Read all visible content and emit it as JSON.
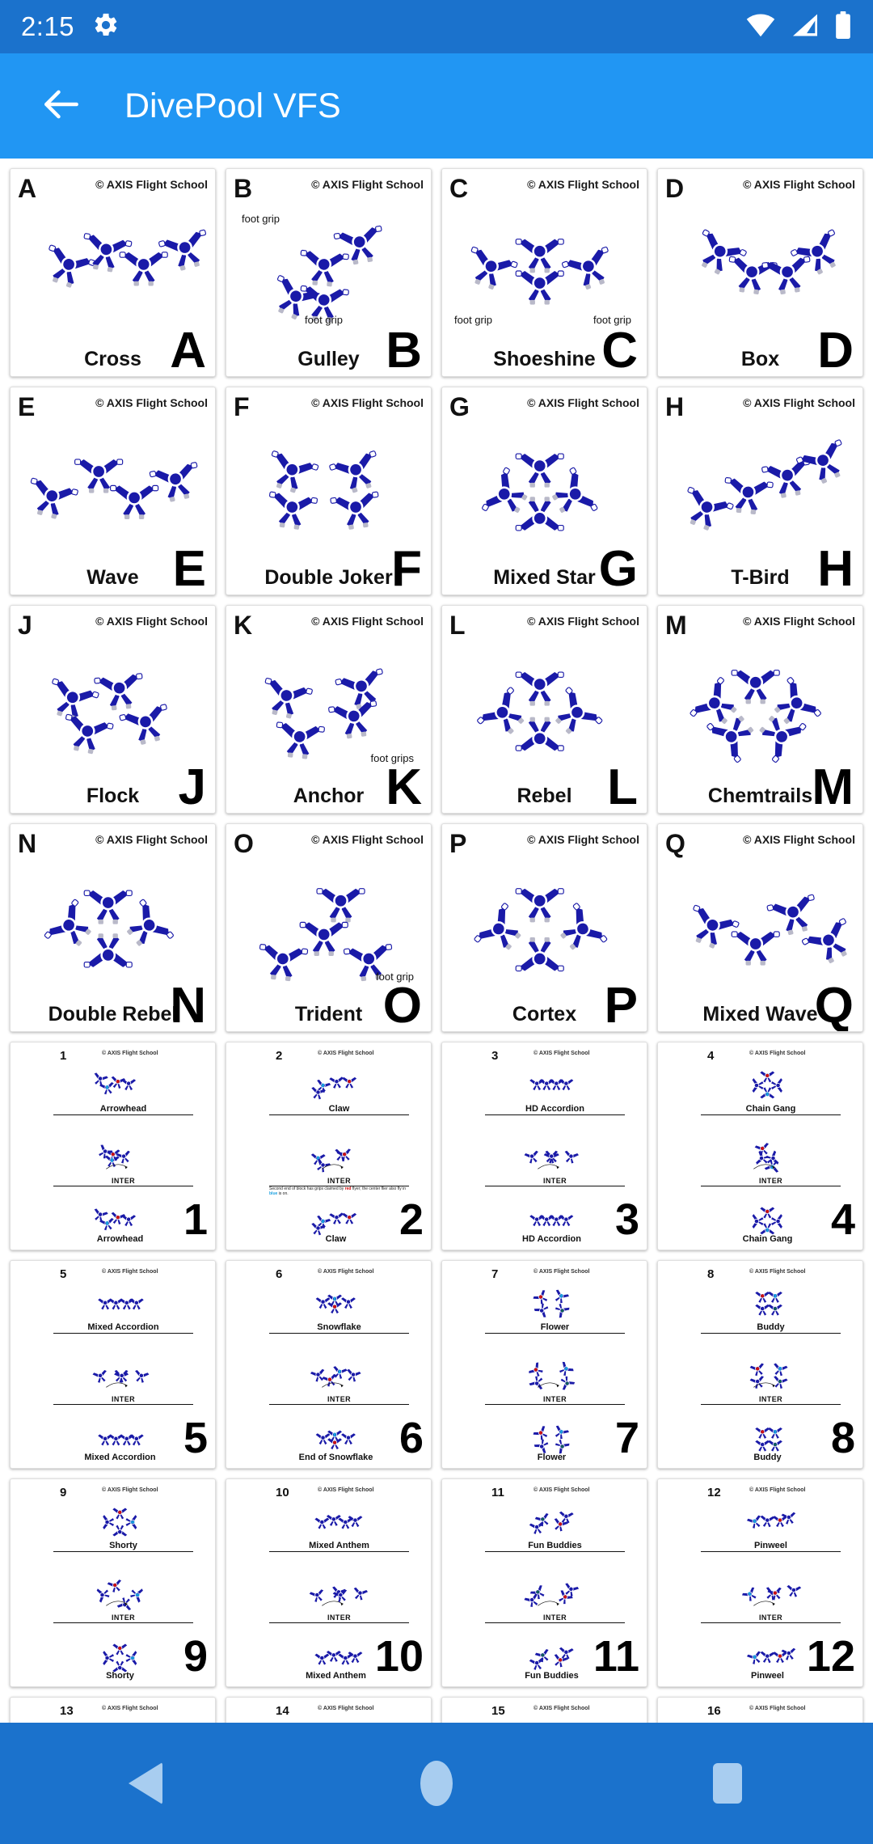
{
  "status_bar": {
    "time": "2:15",
    "left_icons": [
      "gear-icon"
    ],
    "right_icons": [
      "wifi-icon",
      "cellular-signal-icon",
      "battery-icon"
    ],
    "background_color": "#1b72cc"
  },
  "app_bar": {
    "title": "DivePool VFS",
    "back_icon": "arrow-left-icon",
    "background_color": "#2196f3"
  },
  "copyright": "© AXIS Flight School",
  "inter_label": "INTER",
  "colors": {
    "formation_blue": "#1a1aa8",
    "accent_blue": "#2196f3",
    "status_blue": "#1b72cc",
    "nav_icon_blue": "#a8cdf0",
    "red_marker": "#cc1111",
    "cyan_marker": "#19a0e0",
    "green_marker": "#0a8a2a"
  },
  "letter_cards": [
    {
      "letter": "A",
      "name": "Cross",
      "annotations": []
    },
    {
      "letter": "B",
      "name": "Gulley",
      "annotations": [
        "foot grip",
        "foot grip"
      ]
    },
    {
      "letter": "C",
      "name": "Shoeshine",
      "annotations": [
        "foot grip",
        "foot grip"
      ]
    },
    {
      "letter": "D",
      "name": "Box",
      "annotations": []
    },
    {
      "letter": "E",
      "name": "Wave",
      "annotations": []
    },
    {
      "letter": "F",
      "name": "Double Joker",
      "annotations": []
    },
    {
      "letter": "G",
      "name": "Mixed Star",
      "annotations": []
    },
    {
      "letter": "H",
      "name": "T-Bird",
      "annotations": []
    },
    {
      "letter": "J",
      "name": "Flock",
      "annotations": []
    },
    {
      "letter": "K",
      "name": "Anchor",
      "annotations": [
        "foot grips"
      ]
    },
    {
      "letter": "L",
      "name": "Rebel",
      "annotations": []
    },
    {
      "letter": "M",
      "name": "Chemtrails",
      "annotations": []
    },
    {
      "letter": "N",
      "name": "Double Rebel",
      "annotations": []
    },
    {
      "letter": "O",
      "name": "Trident",
      "annotations": [
        "foot grip"
      ]
    },
    {
      "letter": "P",
      "name": "Cortex",
      "annotations": []
    },
    {
      "letter": "Q",
      "name": "Mixed Wave",
      "annotations": []
    }
  ],
  "number_cards": [
    {
      "number": "1",
      "top_name": "Arrowhead",
      "bottom_name": "Arrowhead",
      "note": ""
    },
    {
      "number": "2",
      "top_name": "Claw",
      "bottom_name": "Claw",
      "note": "Second end of block has grips claimed by red flyer; the center flier also fly in blue is on."
    },
    {
      "number": "3",
      "top_name": "HD Accordion",
      "bottom_name": "HD Accordion",
      "note": ""
    },
    {
      "number": "4",
      "top_name": "Chain Gang",
      "bottom_name": "Chain Gang",
      "note": ""
    },
    {
      "number": "5",
      "top_name": "Mixed Accordion",
      "bottom_name": "Mixed Accordion",
      "note": ""
    },
    {
      "number": "6",
      "top_name": "Snowflake",
      "bottom_name": "End of Snowflake",
      "note": ""
    },
    {
      "number": "7",
      "top_name": "Flower",
      "bottom_name": "Flower",
      "note": ""
    },
    {
      "number": "8",
      "top_name": "Buddy",
      "bottom_name": "Buddy",
      "note": ""
    },
    {
      "number": "9",
      "top_name": "Shorty",
      "bottom_name": "Shorty",
      "note": ""
    },
    {
      "number": "10",
      "top_name": "Mixed Anthem",
      "bottom_name": "Mixed Anthem",
      "note": ""
    },
    {
      "number": "11",
      "top_name": "Fun Buddies",
      "bottom_name": "Fun Buddies",
      "note": ""
    },
    {
      "number": "12",
      "top_name": "Pinweel",
      "bottom_name": "Pinweel",
      "note": ""
    }
  ],
  "clipped_cards": [
    {
      "number": "13"
    },
    {
      "number": "14"
    },
    {
      "number": "15"
    },
    {
      "number": "16"
    }
  ],
  "nav_bar": {
    "icons": [
      "back-triangle-icon",
      "home-circle-icon",
      "recents-square-icon"
    ],
    "background_color": "#1b72cc"
  }
}
